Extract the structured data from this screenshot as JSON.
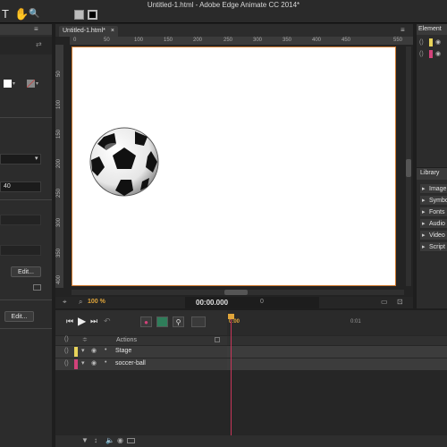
{
  "window": {
    "title": "Untitled-1.html - Adobe Edge Animate CC 2014*"
  },
  "toolbar": {
    "tools": [
      "T",
      "✋",
      "🔍"
    ]
  },
  "document": {
    "tab_label": "Untitled-1.html*"
  },
  "ruler": {
    "h_ticks": [
      "0",
      "50",
      "100",
      "150",
      "200",
      "250",
      "300",
      "350",
      "400",
      "450",
      "550"
    ],
    "v_ticks": [
      "50",
      "100",
      "150",
      "200",
      "250",
      "300",
      "350",
      "400"
    ]
  },
  "properties": {
    "value_field": "40",
    "edit_button_1": "Edit...",
    "edit_button_2": "Edit..."
  },
  "stage_footer": {
    "zoom": "100 %",
    "timecode": "00:00.000",
    "position": "0"
  },
  "elements_panel": {
    "title": "Element"
  },
  "library_panel": {
    "title": "Library",
    "items": [
      "Image",
      "Symbo",
      "Fonts",
      "Audio",
      "Video",
      "Script"
    ]
  },
  "timeline": {
    "playhead_time": "0:00",
    "time_mark": "0:01",
    "actions_label": "Actions",
    "layers": [
      {
        "name": "Stage",
        "color": "#e8d35a"
      },
      {
        "name": "soccer-ball",
        "color": "#d2427a"
      }
    ]
  },
  "colors": {
    "accent": "#e0a53a",
    "playhead": "#c9365a",
    "stage_border": "#d07a2e"
  }
}
